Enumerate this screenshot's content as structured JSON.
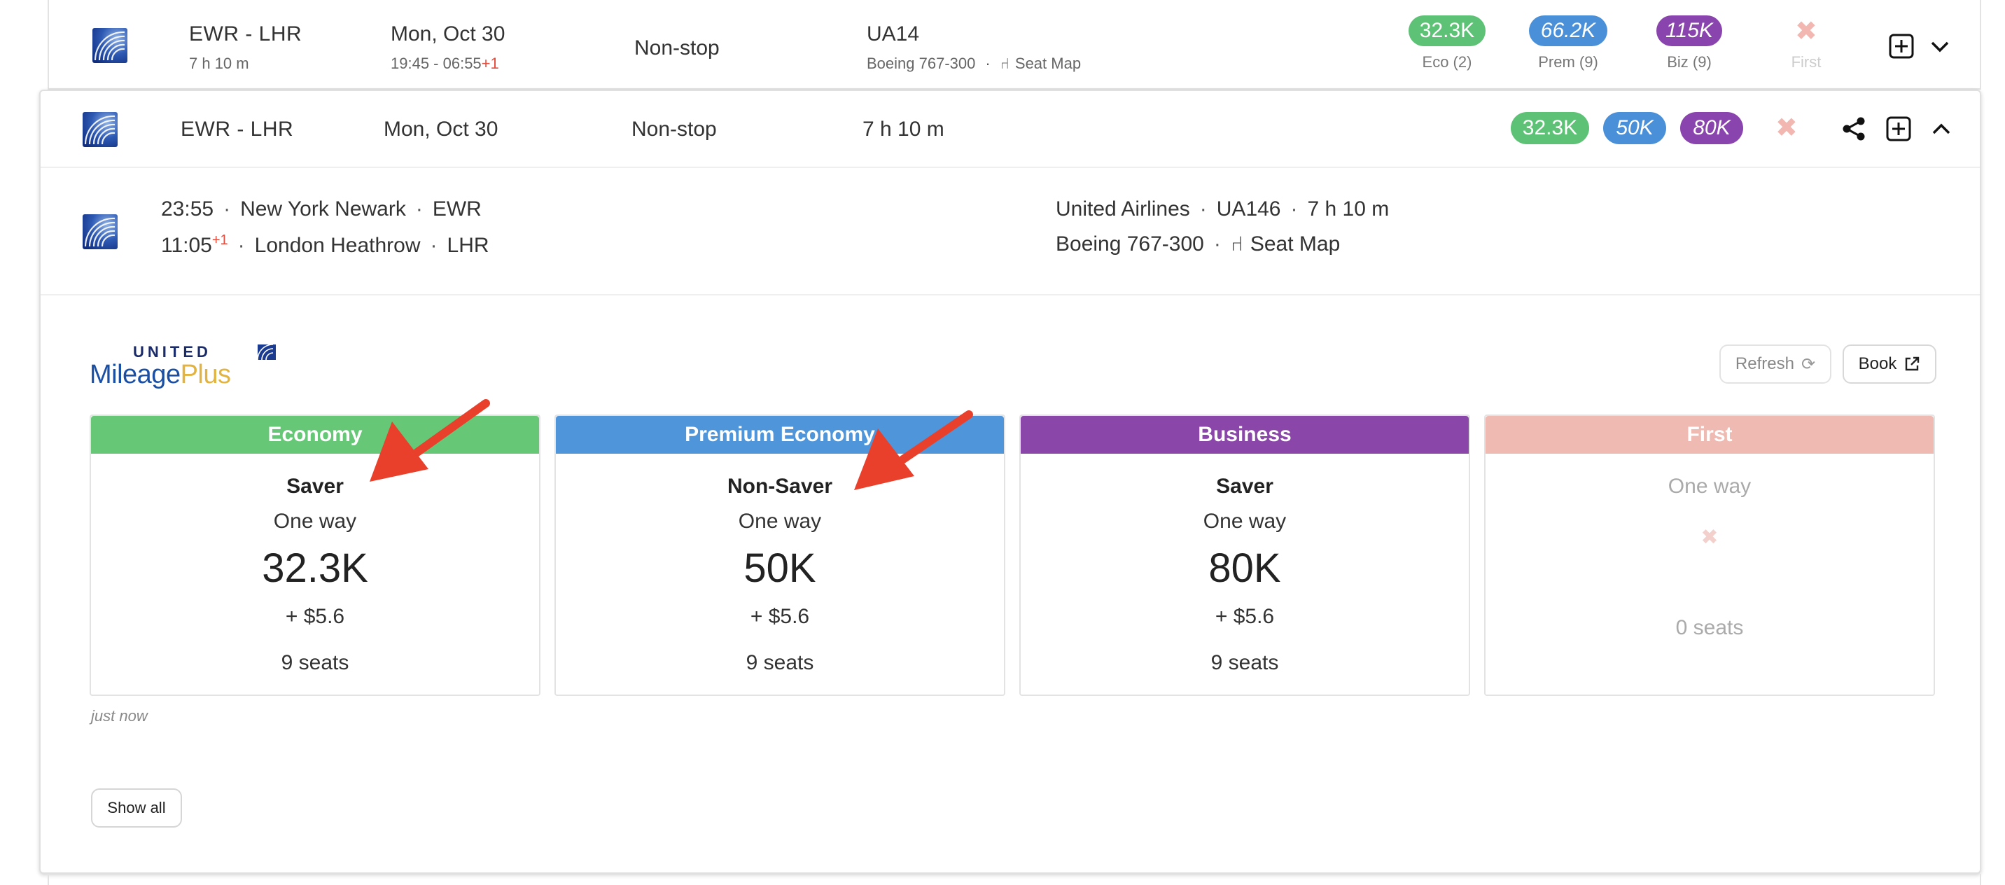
{
  "top_row": {
    "route": "EWR - LHR",
    "duration": "7 h 10 m",
    "date": "Mon, Oct 30",
    "times": "19:45 - 06:55",
    "day_offset": "+1",
    "stops": "Non-stop",
    "flight": "UA14",
    "aircraft": "Boeing 767-300",
    "seat_map": "Seat Map",
    "fares": [
      {
        "value": "32.3K",
        "caption": "Eco (2)",
        "color": "#5dc275"
      },
      {
        "value": "66.2K",
        "caption": "Prem (9)",
        "color": "#4a90d9"
      },
      {
        "value": "115K",
        "caption": "Biz (9)",
        "color": "#8a44ad"
      }
    ],
    "first_caption": "First"
  },
  "card": {
    "route": "EWR - LHR",
    "date": "Mon, Oct 30",
    "stops": "Non-stop",
    "duration": "7 h 10 m",
    "fares": [
      {
        "value": "32.3K",
        "color": "#5dc275"
      },
      {
        "value": "50K",
        "color": "#4a90d9"
      },
      {
        "value": "80K",
        "color": "#8a44ad"
      }
    ],
    "segment": {
      "dep_time": "23:55",
      "dep_city": "New York Newark",
      "dep_code": "EWR",
      "arr_time": "11:05",
      "arr_offset": "+1",
      "arr_city": "London Heathrow",
      "arr_code": "LHR",
      "airline": "United Airlines",
      "flight": "UA146",
      "duration": "7 h 10 m",
      "aircraft": "Boeing 767-300",
      "seat_map": "Seat Map"
    },
    "program": {
      "brand_top": "UNITED",
      "brand_a": "Mileage",
      "brand_b": "Plus"
    },
    "buttons": {
      "refresh": "Refresh",
      "book": "Book",
      "show_all": "Show all"
    },
    "cabins": [
      {
        "name": "Economy",
        "color": "#66c877",
        "type": "Saver",
        "way": "One way",
        "miles": "32.3K",
        "tax": "+ $5.6",
        "seats": "9 seats"
      },
      {
        "name": "Premium Economy",
        "color": "#4f95da",
        "type": "Non-Saver",
        "way": "One way",
        "miles": "50K",
        "tax": "+ $5.6",
        "seats": "9 seats"
      },
      {
        "name": "Business",
        "color": "#8b46a9",
        "type": "Saver",
        "way": "One way",
        "miles": "80K",
        "tax": "+ $5.6",
        "seats": "9 seats"
      },
      {
        "name": "First",
        "color": "#efbab1",
        "type": "",
        "way": "One way",
        "miles": "",
        "tax": "",
        "seats": "0 seats"
      }
    ],
    "timestamp": "just now"
  }
}
